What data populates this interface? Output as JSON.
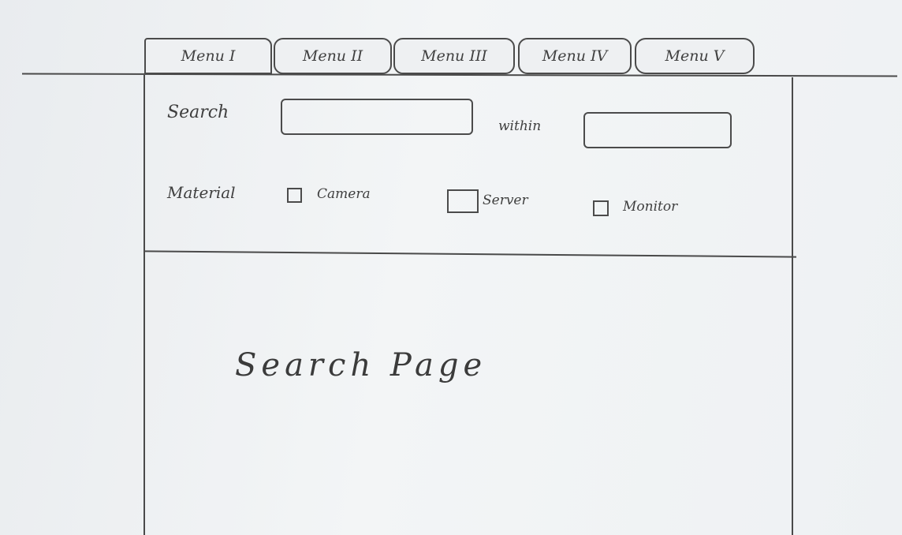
{
  "menu": {
    "tabs": [
      "Menu I",
      "Menu II",
      "Menu III",
      "Menu IV",
      "Menu V"
    ]
  },
  "search": {
    "label": "Search",
    "value": "",
    "within_label": "within",
    "within_value": ""
  },
  "material": {
    "label": "Material",
    "options": [
      {
        "label": "Camera",
        "checked": false
      },
      {
        "label": "Server",
        "checked": false
      },
      {
        "label": "Monitor",
        "checked": false
      }
    ]
  },
  "content": {
    "text": "Search Page"
  }
}
